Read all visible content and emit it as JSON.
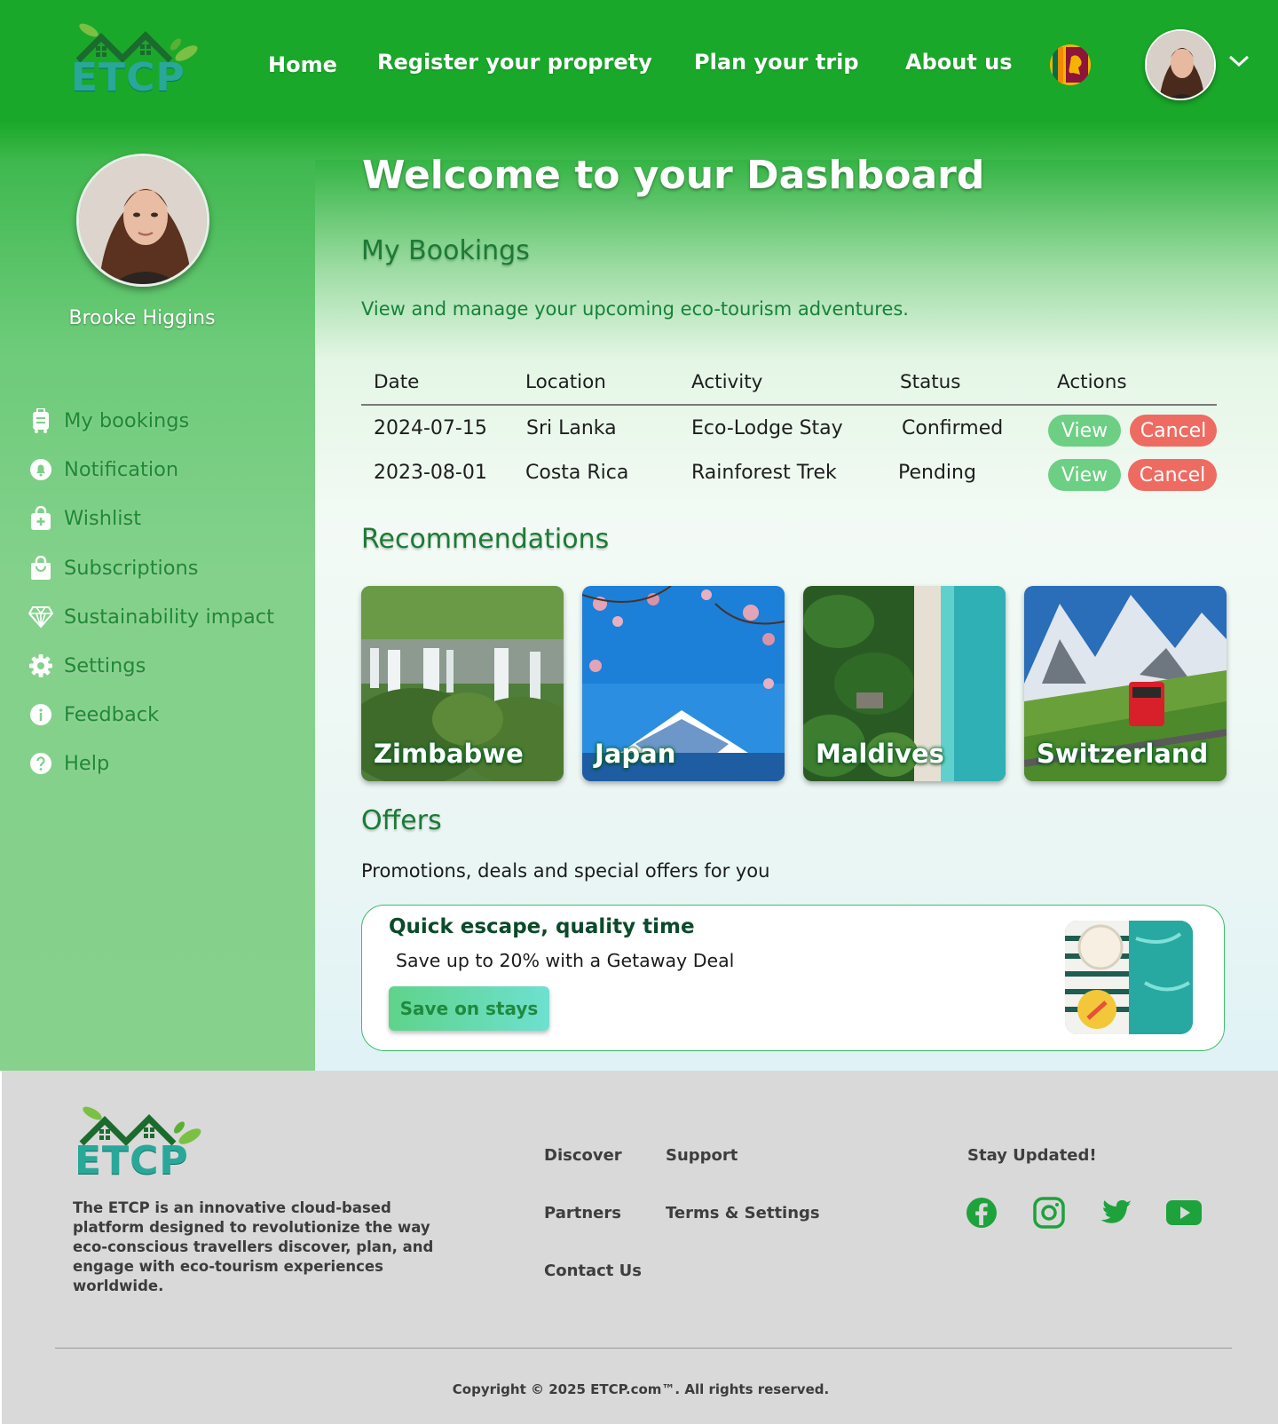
{
  "header": {
    "nav": [
      "Home",
      "Register your proprety",
      "Plan your trip",
      "About us"
    ],
    "logo_text": "ETCP"
  },
  "sidebar": {
    "user_name": "Brooke Higgins",
    "items": [
      {
        "label": "My bookings",
        "icon": "luggage-icon"
      },
      {
        "label": "Notification",
        "icon": "bell-icon"
      },
      {
        "label": "Wishlist",
        "icon": "bag-plus-icon"
      },
      {
        "label": "Subscriptions",
        "icon": "shopping-bag-icon"
      },
      {
        "label": "Sustainability impact",
        "icon": "diamond-icon"
      },
      {
        "label": "Settings",
        "icon": "gear-icon"
      },
      {
        "label": "Feedback",
        "icon": "info-icon"
      },
      {
        "label": "Help",
        "icon": "question-icon"
      }
    ]
  },
  "main": {
    "title": "Welcome to your Dashboard",
    "bookings": {
      "title": "My Bookings",
      "subtitle": "View and manage your upcoming eco-tourism adventures.",
      "columns": [
        "Date",
        "Location",
        "Activity",
        "Status",
        "Actions"
      ],
      "rows": [
        {
          "date": "2024-07-15",
          "location": "Sri Lanka",
          "activity": "Eco-Lodge Stay",
          "status": "Confirmed",
          "view": "View",
          "cancel": "Cancel"
        },
        {
          "date": "2023-08-01",
          "location": "Costa Rica",
          "activity": "Rainforest Trek",
          "status": "Pending",
          "view": "View",
          "cancel": "Cancel"
        }
      ]
    },
    "recommendations": {
      "title": "Recommendations",
      "cards": [
        "Zimbabwe",
        "Japan",
        "Maldives",
        "Switzerland"
      ]
    },
    "offers": {
      "title": "Offers",
      "subtitle": "Promotions, deals and special offers for you",
      "card_title": "Quick escape, quality time",
      "card_desc": "Save up to 20% with a Getaway Deal",
      "button": "Save on stays"
    }
  },
  "footer": {
    "about": "The ETCP is an innovative cloud-based platform designed to revolutionize the way eco-conscious travellers discover, plan, and engage with eco-tourism experiences worldwide.",
    "links": [
      "Discover",
      "Support",
      "Partners",
      "Terms & Settings",
      "Contact Us"
    ],
    "stay_updated": "Stay Updated!",
    "social": [
      "facebook-icon",
      "instagram-icon",
      "twitter-icon",
      "youtube-icon"
    ],
    "copyright": "Copyright © 2025 ETCP.com™. All rights reserved."
  },
  "colors": {
    "brand_green": "#1aa82a",
    "view_button": "#6dcf83",
    "cancel_button": "#ee6b62",
    "footer_bg": "#d9d9d9"
  }
}
